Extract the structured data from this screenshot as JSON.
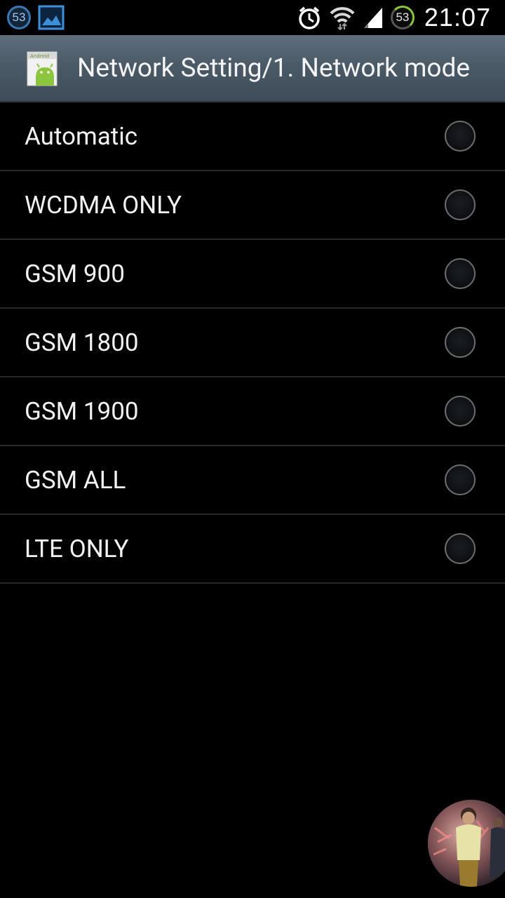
{
  "status_bar": {
    "left_badge": "53",
    "right_badge": "53",
    "time": "21:07"
  },
  "action_bar": {
    "title": "Network Setting/1. Network mode",
    "app_icon_caption": "Android"
  },
  "options": [
    {
      "label": "Automatic",
      "selected": false
    },
    {
      "label": "WCDMA ONLY",
      "selected": false
    },
    {
      "label": "GSM 900",
      "selected": false
    },
    {
      "label": "GSM 1800",
      "selected": false
    },
    {
      "label": "GSM 1900",
      "selected": false
    },
    {
      "label": "GSM ALL",
      "selected": false
    },
    {
      "label": "LTE ONLY",
      "selected": false
    }
  ],
  "colors": {
    "action_bar": "#4b5a67",
    "background": "#000000",
    "accent_blue": "#3a78b5",
    "accent_green": "#8ac43b"
  },
  "icons": {
    "status_left": [
      "count-badge-icon",
      "gallery-icon"
    ],
    "status_right": [
      "alarm-icon",
      "wifi-icon",
      "signal-icon",
      "battery-badge-icon"
    ],
    "app": "android-app-icon",
    "floating": "chat-head-avatar"
  }
}
